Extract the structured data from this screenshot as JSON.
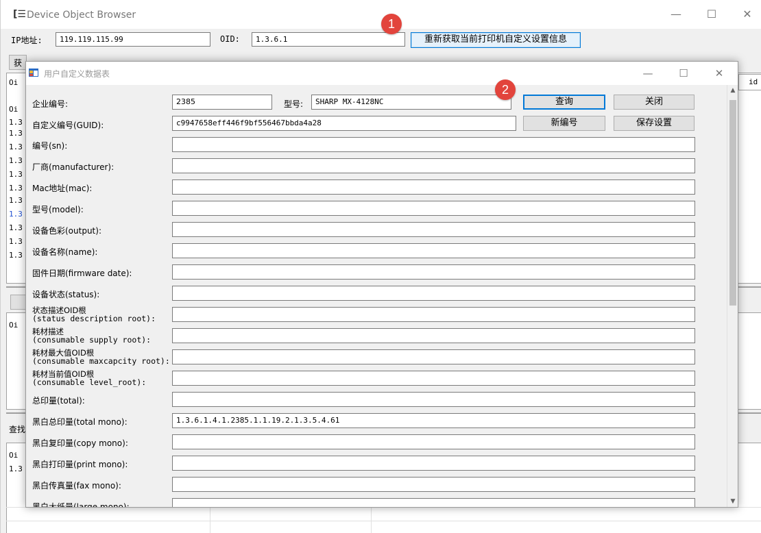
{
  "main_window": {
    "title": "Device Object Browser",
    "ip_label": "IP地址:",
    "ip_value": "119.119.115.99",
    "oid_label": "OID:",
    "oid_value": "1.3.6.1",
    "refetch_button": "重新获取当前打印机自定义设置信息",
    "bg_fragments": {
      "get_btn": "获",
      "oid_col_1": "Oi",
      "oid_col_2": "Oi",
      "oid_col_3": "Oi",
      "oid_col_4": "Oi",
      "id_col": "id",
      "query_label": "查找",
      "rows_top": [
        "1.3",
        "1.3",
        "1.3",
        "1.3",
        "1.3",
        "1.3",
        "1.3",
        "1.3",
        "1.3",
        "1.3",
        "1.3"
      ],
      "rows_bottom": [
        "1.3"
      ]
    }
  },
  "badges": [
    "1",
    "2"
  ],
  "dialog": {
    "title": "用户自定义数据表",
    "enterprise_label": "企业编号:",
    "enterprise_value": "2385",
    "model_label": "型号:",
    "model_value": "SHARP MX-4128NC",
    "query_button": "查询",
    "close_button": "关闭",
    "guid_label": "自定义编号(GUID):",
    "guid_value": "c9947658eff446f9bf556467bbda4a28",
    "new_id_button": "新编号",
    "save_button": "保存设置",
    "fields": [
      {
        "label": "编号(sn):",
        "value": ""
      },
      {
        "label": "厂商(manufacturer):",
        "value": ""
      },
      {
        "label": "Mac地址(mac):",
        "value": ""
      },
      {
        "label": "型号(model):",
        "value": ""
      },
      {
        "label": "设备色彩(output):",
        "value": ""
      },
      {
        "label": "设备名称(name):",
        "value": ""
      },
      {
        "label": "固件日期(firmware date):",
        "value": ""
      },
      {
        "label": "设备状态(status):",
        "value": ""
      },
      {
        "label": "状态描述OID根",
        "label2": "(status description root):",
        "value": ""
      },
      {
        "label": "耗材描述",
        "label2": "(consumable supply root):",
        "value": ""
      },
      {
        "label": "耗材最大值OID根",
        "label2": "(consumable maxcapcity root):",
        "value": ""
      },
      {
        "label": "耗材当前值OID根",
        "label2": "(consumable level_root):",
        "value": ""
      },
      {
        "label": "总印量(total):",
        "value": ""
      },
      {
        "label": "黑白总印量(total mono):",
        "value": "1.3.6.1.4.1.2385.1.1.19.2.1.3.5.4.61"
      },
      {
        "label": "黑白复印量(copy mono):",
        "value": ""
      },
      {
        "label": "黑白打印量(print mono):",
        "value": ""
      },
      {
        "label": "黑白传真量(fax mono):",
        "value": ""
      },
      {
        "label": "黑白大纸量(large mono):",
        "value": ""
      }
    ]
  }
}
